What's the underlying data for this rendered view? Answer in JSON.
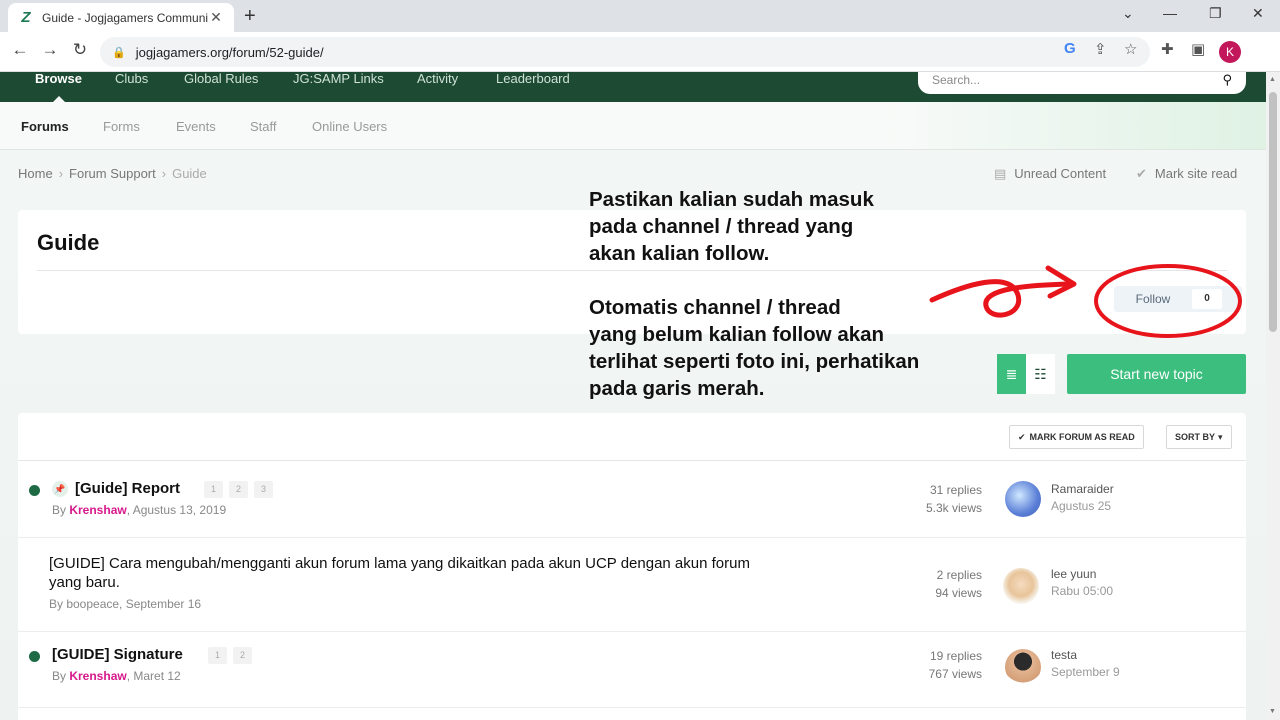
{
  "browser": {
    "tab_title": "Guide - Jogjagamers Community",
    "url": "jogjagamers.org/forum/52-guide/",
    "profile_initial": "K"
  },
  "site": {
    "top_nav": [
      "Browse",
      "Clubs",
      "Global Rules",
      "JG:SAMP Links",
      "Activity",
      "Leaderboard"
    ],
    "search_placeholder": "Search...",
    "sub_nav": [
      "Forums",
      "Forms",
      "Events",
      "Staff",
      "Online Users"
    ],
    "breadcrumb": [
      "Home",
      "Forum Support",
      "Guide"
    ],
    "unread_content": "Unread Content",
    "mark_site_read": "Mark site read"
  },
  "forum": {
    "title": "Guide",
    "follow_label": "Follow",
    "follow_count": "0",
    "start_topic": "Start new topic",
    "mark_forum_read": "MARK FORUM AS READ",
    "sort_by": "SORT BY"
  },
  "topics": [
    {
      "title": "[Guide] Report",
      "pages": [
        "1",
        "2",
        "3"
      ],
      "by": "By ",
      "author": "Krenshaw",
      "date": ", Agustus 13, 2019",
      "replies": "31 replies",
      "views": "5.3k views",
      "last_user": "Ramaraider",
      "last_time": "Agustus 25"
    },
    {
      "title_line1": "[GUIDE] Cara mengubah/mengganti akun forum lama yang dikaitkan pada akun UCP dengan akun forum",
      "title_line2": "yang baru.",
      "by": "By boopeace, September 16",
      "replies": "2 replies",
      "views": "94 views",
      "last_user": "lee yuun",
      "last_time": "Rabu 05:00"
    },
    {
      "title": "[GUIDE] Signature",
      "pages": [
        "1",
        "2"
      ],
      "by": "By ",
      "author": "Krenshaw",
      "date": ", Maret 12",
      "replies": "19 replies",
      "views": "767 views",
      "last_user": "testa",
      "last_time": "September 9"
    }
  ],
  "annotation": {
    "line1": "Pastikan kalian sudah masuk",
    "line2": "pada channel / thread yang",
    "line3": "akan kalian follow.",
    "line4": "Otomatis channel / thread",
    "line5": "yang belum kalian follow akan",
    "line6": "terlihat seperti foto ini, perhatikan",
    "line7": "pada garis merah.",
    "color": "#e8141b"
  }
}
